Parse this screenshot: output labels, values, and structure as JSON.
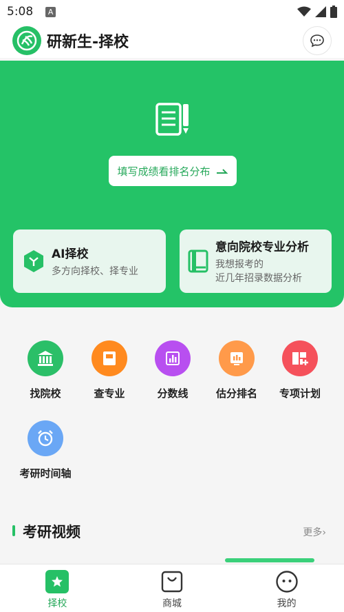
{
  "status_bar": {
    "time": "5:08",
    "notif_letter": "A"
  },
  "header": {
    "title": "研新生-择校"
  },
  "hero": {
    "fill_button_label": "填写成绩看排名分布",
    "ai_card": {
      "title": "AI择校",
      "subtitle": "多方向择校、择专业"
    },
    "analysis_card": {
      "title": "意向院校专业分析",
      "subtitle_line1": "我想报考的",
      "subtitle_line2": "近几年招录数据分析"
    }
  },
  "functions": [
    {
      "label": "找院校",
      "icon": "building-icon",
      "color": "#2bbf68"
    },
    {
      "label": "查专业",
      "icon": "book-icon",
      "color": "#ff8a1f"
    },
    {
      "label": "分数线",
      "icon": "bar-chart-icon",
      "color": "#b84ff0"
    },
    {
      "label": "估分排名",
      "icon": "report-icon",
      "color": "#ff9a4a"
    },
    {
      "label": "专项计划",
      "icon": "plan-book-icon",
      "color": "#f5515b"
    },
    {
      "label": "考研时间轴",
      "icon": "alarm-clock-icon",
      "color": "#6aa7f5"
    }
  ],
  "video_section": {
    "title": "考研视频",
    "more": "更多›"
  },
  "tabs": [
    {
      "label": "择校",
      "icon": "star-icon",
      "active": true
    },
    {
      "label": "商城",
      "icon": "shopping-bag-icon",
      "active": false
    },
    {
      "label": "我的",
      "icon": "face-icon",
      "active": false
    }
  ],
  "colors": {
    "brand_green": "#24c367",
    "card_bg": "#e8f6ee"
  }
}
